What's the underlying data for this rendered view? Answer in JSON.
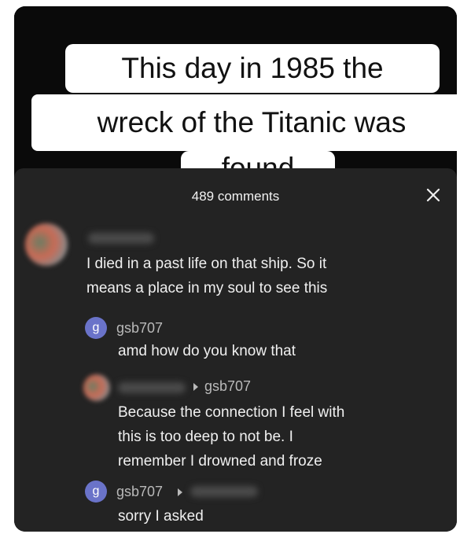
{
  "video": {
    "caption_line1": "This day in 1985 the",
    "caption_line2": "wreck of the Titanic was",
    "caption_line3": "found"
  },
  "sheet": {
    "comment_count": "489 comments",
    "close_icon": "close-icon"
  },
  "comments": [
    {
      "avatar": "blurred-avatar",
      "username": "",
      "text_line1": "I died in a past life on that ship. So it",
      "text_line2": "means a place in my soul to see this"
    },
    {
      "avatar_letter": "g",
      "username": "gsb707",
      "text_line1": "amd how do you know that"
    },
    {
      "avatar": "blurred-avatar",
      "reply_to": "gsb707",
      "text_line1": "Because the connection I feel with",
      "text_line2": "this is too deep to not be. I",
      "text_line3": "remember I drowned and froze"
    },
    {
      "avatar_letter": "g",
      "username": "gsb707",
      "text_line1": "sorry I asked"
    }
  ],
  "colors": {
    "sheet_bg": "#232323",
    "avatar_g": "#6a73c9",
    "text": "#f0f0f0",
    "muted": "#b9b9b9"
  }
}
